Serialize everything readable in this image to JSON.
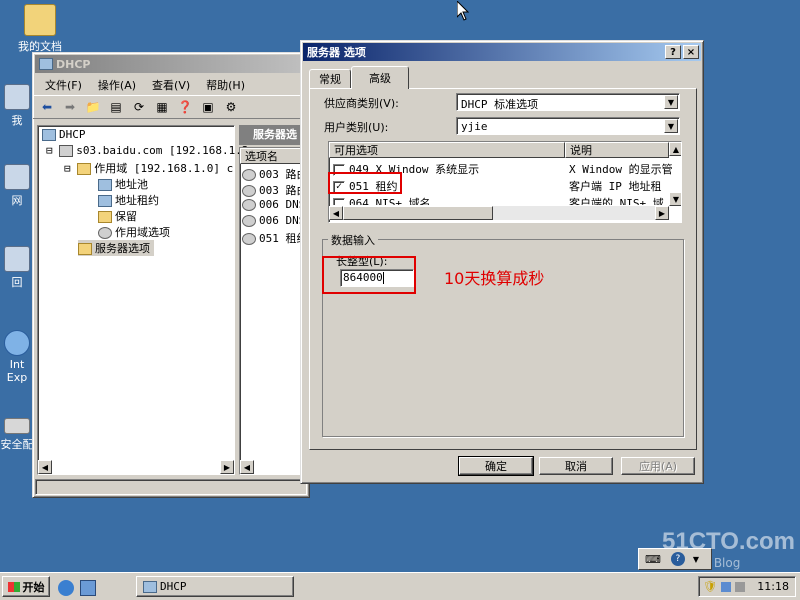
{
  "desktop": {
    "icons": [
      {
        "label": "我的文档",
        "icon": "folder-icon"
      },
      {
        "label": "我",
        "icon": "computer-icon"
      },
      {
        "label": "网",
        "icon": "network-icon"
      },
      {
        "label": "回",
        "icon": "recycle-bin-icon"
      },
      {
        "label": "Int",
        "label2": "Exp",
        "icon": "ie-icon"
      },
      {
        "label": "安全配",
        "icon": "security-icon"
      }
    ]
  },
  "dhcp": {
    "title": "DHCP",
    "menu": [
      "文件(F)",
      "操作(A)",
      "查看(V)",
      "帮助(H)"
    ],
    "tree": {
      "root": "DHCP",
      "server": "s03.baidu.com [192.168.1.2",
      "scope": "作用域 [192.168.1.0] c",
      "children": [
        "地址池",
        "地址租约",
        "保留",
        "作用域选项"
      ],
      "server_options": "服务器选项"
    },
    "right_header": "服务器选",
    "list_header": "选项名",
    "list_items": [
      "003 路由",
      "003 路由",
      "006 DNS",
      "006 DNS",
      "051 租约"
    ]
  },
  "dialog": {
    "title": "服务器 选项",
    "help_btn": "?",
    "close_btn": "×",
    "tabs": [
      "常规",
      "高级"
    ],
    "vendor_label": "供应商类别(V):",
    "vendor_value": "DHCP 标准选项",
    "user_label": "用户类别(U):",
    "user_value": "yjie",
    "options_header": [
      "可用选项",
      "说明"
    ],
    "options": [
      {
        "name": "049 X Window 系统显示",
        "desc": "X Window 的显示管",
        "checked": false
      },
      {
        "name": "051 租约",
        "desc": "客户端 IP 地址租",
        "checked": true
      },
      {
        "name": "064 NIS+ 域名",
        "desc": "客户端的 NIS+ 域",
        "checked": false
      }
    ],
    "data_group": "数据输入",
    "long_label": "长整型(L):",
    "long_value": "864000",
    "annotation": "10天换算成秒",
    "ok": "确定",
    "cancel": "取消",
    "apply": "应用(A)"
  },
  "taskbar": {
    "start": "开始",
    "task": "DHCP",
    "clock": "11:18"
  },
  "watermark": {
    "line1": "51CTO.com",
    "line2": "技术博客  Blog"
  },
  "colors": {
    "desktop": "#3a6ea5",
    "annotation": "#e00000"
  }
}
